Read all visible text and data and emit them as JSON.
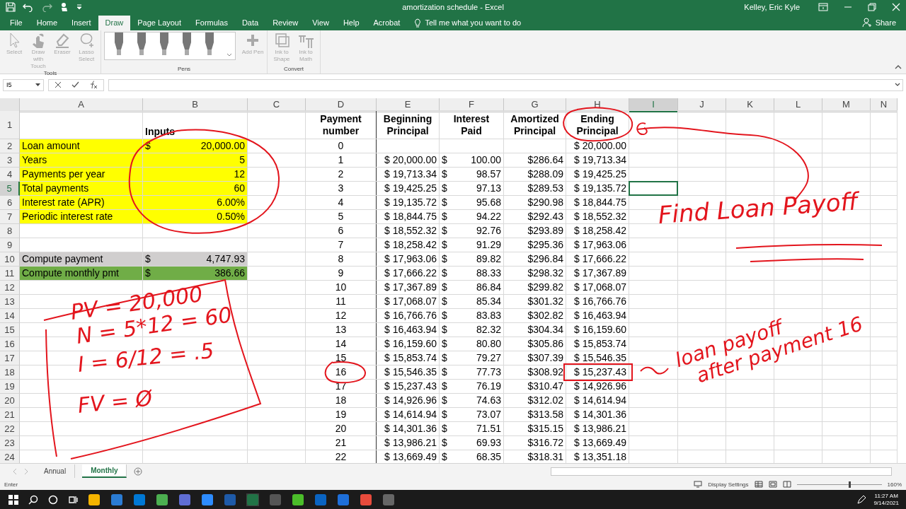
{
  "window": {
    "title": "amortization schedule  -  Excel",
    "user": "Kelley, Eric Kyle"
  },
  "tabs": [
    {
      "label": "File",
      "selected": false
    },
    {
      "label": "Home",
      "selected": false
    },
    {
      "label": "Insert",
      "selected": false
    },
    {
      "label": "Draw",
      "selected": true
    },
    {
      "label": "Page Layout",
      "selected": false
    },
    {
      "label": "Formulas",
      "selected": false
    },
    {
      "label": "Data",
      "selected": false
    },
    {
      "label": "Review",
      "selected": false
    },
    {
      "label": "View",
      "selected": false
    },
    {
      "label": "Help",
      "selected": false
    },
    {
      "label": "Acrobat",
      "selected": false
    }
  ],
  "tell_me": "Tell me what you want to do",
  "share": "Share",
  "ribbon": {
    "groups": [
      {
        "label": "Tools",
        "kind": "buttons",
        "items": [
          {
            "label": "Select",
            "kind": "pointer",
            "disabled": true
          },
          {
            "label": "Draw with Touch",
            "kind": "hand",
            "disabled": true
          },
          {
            "label": "Eraser",
            "kind": "eraser",
            "disabled": true
          },
          {
            "label": "Lasso Select",
            "kind": "lasso",
            "disabled": true
          }
        ]
      },
      {
        "label": "Pens",
        "kind": "pens",
        "items": [
          {
            "label": "Add Pen",
            "kind": "plus",
            "disabled": true
          }
        ]
      },
      {
        "label": "Convert",
        "kind": "buttons",
        "items": [
          {
            "label": "Ink to Shape",
            "kind": "shape",
            "disabled": true
          },
          {
            "label": "Ink to Math",
            "kind": "math",
            "disabled": true
          }
        ]
      }
    ]
  },
  "name_box": "I5",
  "columns": [
    {
      "label": "A",
      "selected": false
    },
    {
      "label": "B",
      "selected": false
    },
    {
      "label": "C",
      "selected": false
    },
    {
      "label": "D",
      "selected": false
    },
    {
      "label": "E",
      "selected": false
    },
    {
      "label": "F",
      "selected": false
    },
    {
      "label": "G",
      "selected": false
    },
    {
      "label": "H",
      "selected": false
    },
    {
      "label": "I",
      "selected": true
    },
    {
      "label": "J",
      "selected": false
    },
    {
      "label": "K",
      "selected": false
    },
    {
      "label": "L",
      "selected": false
    },
    {
      "label": "M",
      "selected": false
    },
    {
      "label": "N",
      "selected": false
    }
  ],
  "rows": [
    {
      "num": "1",
      "selected": false,
      "cells": [
        null,
        {
          "kind": "title",
          "text": "Inputs"
        },
        null,
        {
          "kind": "head",
          "text": "Payment number"
        },
        {
          "kind": "head",
          "text": "Beginning Principal"
        },
        {
          "kind": "head",
          "text": "Interest Paid"
        },
        {
          "kind": "head",
          "text": "Amortized Principal"
        },
        {
          "kind": "head",
          "text": "Ending Principal"
        }
      ]
    },
    {
      "num": "2",
      "selected": false,
      "cells": [
        {
          "kind": "text",
          "text": "Loan amount",
          "color": "#ffff00"
        },
        {
          "kind": "acct",
          "cur": "$",
          "text": "20,000.00",
          "color": "#ffff00"
        },
        null,
        {
          "kind": "center",
          "text": "0"
        },
        null,
        null,
        null,
        {
          "kind": "num",
          "text": "$ 20,000.00"
        }
      ]
    },
    {
      "num": "3",
      "selected": false,
      "cells": [
        {
          "kind": "text",
          "text": "Years",
          "color": "#ffff00"
        },
        {
          "kind": "num",
          "text": "5",
          "color": "#ffff00"
        },
        null,
        {
          "kind": "center",
          "text": "1"
        },
        {
          "kind": "num",
          "text": "$ 20,000.00"
        },
        {
          "kind": "acct",
          "cur": "$",
          "text": "100.00"
        },
        {
          "kind": "num",
          "text": "$286.64"
        },
        {
          "kind": "num",
          "text": "$ 19,713.34"
        }
      ]
    },
    {
      "num": "4",
      "selected": false,
      "cells": [
        {
          "kind": "text",
          "text": "Payments per year",
          "color": "#ffff00"
        },
        {
          "kind": "num",
          "text": "12",
          "color": "#ffff00"
        },
        null,
        {
          "kind": "center",
          "text": "2"
        },
        {
          "kind": "num",
          "text": "$ 19,713.34"
        },
        {
          "kind": "acct",
          "cur": "$",
          "text": "98.57"
        },
        {
          "kind": "num",
          "text": "$288.09"
        },
        {
          "kind": "num",
          "text": "$ 19,425.25"
        }
      ]
    },
    {
      "num": "5",
      "selected": true,
      "cells": [
        {
          "kind": "text",
          "text": "Total payments",
          "color": "#ffff00"
        },
        {
          "kind": "num",
          "text": "60",
          "color": "#ffff00"
        },
        null,
        {
          "kind": "center",
          "text": "3"
        },
        {
          "kind": "num",
          "text": "$ 19,425.25"
        },
        {
          "kind": "acct",
          "cur": "$",
          "text": "97.13"
        },
        {
          "kind": "num",
          "text": "$289.53"
        },
        {
          "kind": "num",
          "text": "$ 19,135.72"
        }
      ]
    },
    {
      "num": "6",
      "selected": false,
      "cells": [
        {
          "kind": "text",
          "text": "Interest rate (APR)",
          "color": "#ffff00"
        },
        {
          "kind": "num",
          "text": "6.00%",
          "color": "#ffff00"
        },
        null,
        {
          "kind": "center",
          "text": "4"
        },
        {
          "kind": "num",
          "text": "$ 19,135.72"
        },
        {
          "kind": "acct",
          "cur": "$",
          "text": "95.68"
        },
        {
          "kind": "num",
          "text": "$290.98"
        },
        {
          "kind": "num",
          "text": "$ 18,844.75"
        }
      ]
    },
    {
      "num": "7",
      "selected": false,
      "cells": [
        {
          "kind": "text",
          "text": "Periodic interest rate",
          "color": "#ffff00"
        },
        {
          "kind": "num",
          "text": "0.50%",
          "color": "#ffff00"
        },
        null,
        {
          "kind": "center",
          "text": "5"
        },
        {
          "kind": "num",
          "text": "$ 18,844.75"
        },
        {
          "kind": "acct",
          "cur": "$",
          "text": "94.22"
        },
        {
          "kind": "num",
          "text": "$292.43"
        },
        {
          "kind": "num",
          "text": "$ 18,552.32"
        }
      ]
    },
    {
      "num": "8",
      "selected": false,
      "cells": [
        null,
        null,
        null,
        {
          "kind": "center",
          "text": "6"
        },
        {
          "kind": "num",
          "text": "$ 18,552.32"
        },
        {
          "kind": "acct",
          "cur": "$",
          "text": "92.76"
        },
        {
          "kind": "num",
          "text": "$293.89"
        },
        {
          "kind": "num",
          "text": "$ 18,258.42"
        }
      ]
    },
    {
      "num": "9",
      "selected": false,
      "cells": [
        null,
        null,
        null,
        {
          "kind": "center",
          "text": "7"
        },
        {
          "kind": "num",
          "text": "$ 18,258.42"
        },
        {
          "kind": "acct",
          "cur": "$",
          "text": "91.29"
        },
        {
          "kind": "num",
          "text": "$295.36"
        },
        {
          "kind": "num",
          "text": "$ 17,963.06"
        }
      ]
    },
    {
      "num": "10",
      "selected": false,
      "cells": [
        {
          "kind": "text",
          "text": "Compute payment",
          "color": "#d0cece"
        },
        {
          "kind": "acct",
          "cur": "$",
          "text": "4,747.93",
          "color": "#d0cece"
        },
        null,
        {
          "kind": "center",
          "text": "8"
        },
        {
          "kind": "num",
          "text": "$ 17,963.06"
        },
        {
          "kind": "acct",
          "cur": "$",
          "text": "89.82"
        },
        {
          "kind": "num",
          "text": "$296.84"
        },
        {
          "kind": "num",
          "text": "$ 17,666.22"
        }
      ]
    },
    {
      "num": "11",
      "selected": false,
      "cells": [
        {
          "kind": "text",
          "text": "Compute monthly pmt",
          "color": "#70ad47"
        },
        {
          "kind": "acct",
          "cur": "$",
          "text": "386.66",
          "color": "#70ad47"
        },
        null,
        {
          "kind": "center",
          "text": "9"
        },
        {
          "kind": "num",
          "text": "$ 17,666.22"
        },
        {
          "kind": "acct",
          "cur": "$",
          "text": "88.33"
        },
        {
          "kind": "num",
          "text": "$298.32"
        },
        {
          "kind": "num",
          "text": "$ 17,367.89"
        }
      ]
    },
    {
      "num": "12",
      "selected": false,
      "cells": [
        null,
        null,
        null,
        {
          "kind": "center",
          "text": "10"
        },
        {
          "kind": "num",
          "text": "$ 17,367.89"
        },
        {
          "kind": "acct",
          "cur": "$",
          "text": "86.84"
        },
        {
          "kind": "num",
          "text": "$299.82"
        },
        {
          "kind": "num",
          "text": "$ 17,068.07"
        }
      ]
    },
    {
      "num": "13",
      "selected": false,
      "cells": [
        null,
        null,
        null,
        {
          "kind": "center",
          "text": "11"
        },
        {
          "kind": "num",
          "text": "$ 17,068.07"
        },
        {
          "kind": "acct",
          "cur": "$",
          "text": "85.34"
        },
        {
          "kind": "num",
          "text": "$301.32"
        },
        {
          "kind": "num",
          "text": "$ 16,766.76"
        }
      ]
    },
    {
      "num": "14",
      "selected": false,
      "cells": [
        null,
        null,
        null,
        {
          "kind": "center",
          "text": "12"
        },
        {
          "kind": "num",
          "text": "$ 16,766.76"
        },
        {
          "kind": "acct",
          "cur": "$",
          "text": "83.83"
        },
        {
          "kind": "num",
          "text": "$302.82"
        },
        {
          "kind": "num",
          "text": "$ 16,463.94"
        }
      ]
    },
    {
      "num": "15",
      "selected": false,
      "cells": [
        null,
        null,
        null,
        {
          "kind": "center",
          "text": "13"
        },
        {
          "kind": "num",
          "text": "$ 16,463.94"
        },
        {
          "kind": "acct",
          "cur": "$",
          "text": "82.32"
        },
        {
          "kind": "num",
          "text": "$304.34"
        },
        {
          "kind": "num",
          "text": "$ 16,159.60"
        }
      ]
    },
    {
      "num": "16",
      "selected": false,
      "cells": [
        null,
        null,
        null,
        {
          "kind": "center",
          "text": "14"
        },
        {
          "kind": "num",
          "text": "$ 16,159.60"
        },
        {
          "kind": "acct",
          "cur": "$",
          "text": "80.80"
        },
        {
          "kind": "num",
          "text": "$305.86"
        },
        {
          "kind": "num",
          "text": "$ 15,853.74"
        }
      ]
    },
    {
      "num": "17",
      "selected": false,
      "cells": [
        null,
        null,
        null,
        {
          "kind": "center",
          "text": "15"
        },
        {
          "kind": "num",
          "text": "$ 15,853.74"
        },
        {
          "kind": "acct",
          "cur": "$",
          "text": "79.27"
        },
        {
          "kind": "num",
          "text": "$307.39"
        },
        {
          "kind": "num",
          "text": "$ 15,546.35"
        }
      ]
    },
    {
      "num": "18",
      "selected": false,
      "cells": [
        null,
        null,
        null,
        {
          "kind": "center",
          "text": "16"
        },
        {
          "kind": "num",
          "text": "$ 15,546.35"
        },
        {
          "kind": "acct",
          "cur": "$",
          "text": "77.73"
        },
        {
          "kind": "num",
          "text": "$308.92"
        },
        {
          "kind": "num",
          "text": "$ 15,237.43"
        }
      ]
    },
    {
      "num": "19",
      "selected": false,
      "cells": [
        null,
        null,
        null,
        {
          "kind": "center",
          "text": "17"
        },
        {
          "kind": "num",
          "text": "$ 15,237.43"
        },
        {
          "kind": "acct",
          "cur": "$",
          "text": "76.19"
        },
        {
          "kind": "num",
          "text": "$310.47"
        },
        {
          "kind": "num",
          "text": "$ 14,926.96"
        }
      ]
    },
    {
      "num": "20",
      "selected": false,
      "cells": [
        null,
        null,
        null,
        {
          "kind": "center",
          "text": "18"
        },
        {
          "kind": "num",
          "text": "$ 14,926.96"
        },
        {
          "kind": "acct",
          "cur": "$",
          "text": "74.63"
        },
        {
          "kind": "num",
          "text": "$312.02"
        },
        {
          "kind": "num",
          "text": "$ 14,614.94"
        }
      ]
    },
    {
      "num": "21",
      "selected": false,
      "cells": [
        null,
        null,
        null,
        {
          "kind": "center",
          "text": "19"
        },
        {
          "kind": "num",
          "text": "$ 14,614.94"
        },
        {
          "kind": "acct",
          "cur": "$",
          "text": "73.07"
        },
        {
          "kind": "num",
          "text": "$313.58"
        },
        {
          "kind": "num",
          "text": "$ 14,301.36"
        }
      ]
    },
    {
      "num": "22",
      "selected": false,
      "cells": [
        null,
        null,
        null,
        {
          "kind": "center",
          "text": "20"
        },
        {
          "kind": "num",
          "text": "$ 14,301.36"
        },
        {
          "kind": "acct",
          "cur": "$",
          "text": "71.51"
        },
        {
          "kind": "num",
          "text": "$315.15"
        },
        {
          "kind": "num",
          "text": "$ 13,986.21"
        }
      ]
    },
    {
      "num": "23",
      "selected": false,
      "cells": [
        null,
        null,
        null,
        {
          "kind": "center",
          "text": "21"
        },
        {
          "kind": "num",
          "text": "$ 13,986.21"
        },
        {
          "kind": "acct",
          "cur": "$",
          "text": "69.93"
        },
        {
          "kind": "num",
          "text": "$316.72"
        },
        {
          "kind": "num",
          "text": "$ 13,669.49"
        }
      ]
    },
    {
      "num": "24",
      "selected": false,
      "cells": [
        null,
        null,
        null,
        {
          "kind": "center",
          "text": "22"
        },
        {
          "kind": "num",
          "text": "$ 13,669.49"
        },
        {
          "kind": "acct",
          "cur": "$",
          "text": "68.35"
        },
        {
          "kind": "num",
          "text": "$318.31"
        },
        {
          "kind": "num",
          "text": "$ 13,351.18"
        }
      ]
    }
  ],
  "ink_notes": [
    {
      "text": "PV = 20,000"
    },
    {
      "text": "N = 5*12 = 60"
    },
    {
      "text": "I = 6/12 = .5"
    },
    {
      "text": "FV = Ø"
    },
    {
      "text": "Find Loan Payoff"
    },
    {
      "text": "loan payoff"
    },
    {
      "text": "after payment 16"
    }
  ],
  "sheet_tabs": [
    {
      "label": "Annual",
      "selected": false
    },
    {
      "label": "Monthly",
      "selected": true
    }
  ],
  "status_bar": {
    "mode": "Enter",
    "display_settings": "Display Settings",
    "zoom_slider": {
      "level": 0.62
    },
    "zoom": "160%"
  },
  "taskbar": {
    "time": "11:27 AM",
    "date": "9/14/2021"
  }
}
